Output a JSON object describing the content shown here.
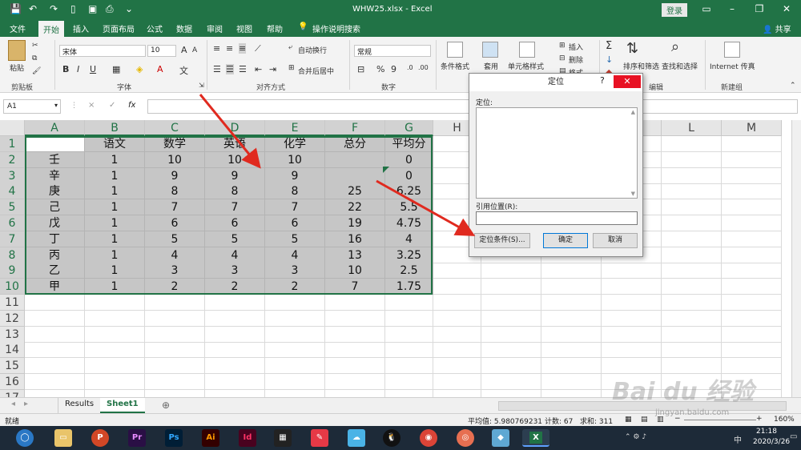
{
  "window": {
    "title": "WHW25.xlsx  -  Excel",
    "login": "登录",
    "share": "共享"
  },
  "tabs": [
    "文件",
    "开始",
    "插入",
    "页面布局",
    "公式",
    "数据",
    "审阅",
    "视图",
    "帮助",
    "操作说明搜索"
  ],
  "ribbon": {
    "clipboard": {
      "paste": "粘贴",
      "group": "剪贴板"
    },
    "font": {
      "name": "宋体",
      "size": "10",
      "bold": "B",
      "italic": "I",
      "underline": "U",
      "grow": "A",
      "shrink": "A",
      "group": "字体"
    },
    "align": {
      "wrap": "自动换行",
      "merge": "合并后居中",
      "group": "对齐方式"
    },
    "number": {
      "format": "常规",
      "percent": "%",
      "comma": "9",
      "group": "数字"
    },
    "styles": {
      "cond": "条件格式",
      "table": "套用",
      "cell": "单元格样式"
    },
    "cells": {
      "insert": "插入",
      "delete": "删除",
      "format": "格式"
    },
    "edit": {
      "sort": "排序和筛选",
      "find": "查找和选择",
      "group": "编辑"
    },
    "new": {
      "internet": "Internet 传真",
      "group": "新建组"
    }
  },
  "formula_bar": {
    "name_box": "A1",
    "cancel": "×",
    "enter": "✓",
    "fx": "fx",
    "value": ""
  },
  "columns": [
    "A",
    "B",
    "C",
    "D",
    "E",
    "F",
    "G",
    "H",
    "I",
    "J",
    "K",
    "L",
    "M"
  ],
  "rows": [
    "1",
    "2",
    "3",
    "4",
    "5",
    "6",
    "7",
    "8",
    "9",
    "10",
    "11",
    "12",
    "13",
    "14",
    "15",
    "16",
    "17"
  ],
  "cells": [
    [
      "",
      "语文",
      "数学",
      "英语",
      "化学",
      "总分",
      "平均分"
    ],
    [
      "壬",
      "1",
      "10",
      "10",
      "10",
      "",
      "0"
    ],
    [
      "辛",
      "1",
      "9",
      "9",
      "9",
      "",
      "0"
    ],
    [
      "庚",
      "1",
      "8",
      "8",
      "8",
      "25",
      "6.25"
    ],
    [
      "己",
      "1",
      "7",
      "7",
      "7",
      "22",
      "5.5"
    ],
    [
      "戊",
      "1",
      "6",
      "6",
      "6",
      "19",
      "4.75"
    ],
    [
      "丁",
      "1",
      "5",
      "5",
      "5",
      "16",
      "4"
    ],
    [
      "丙",
      "1",
      "4",
      "4",
      "4",
      "13",
      "3.25"
    ],
    [
      "乙",
      "1",
      "3",
      "3",
      "3",
      "10",
      "2.5"
    ],
    [
      "甲",
      "1",
      "2",
      "2",
      "2",
      "7",
      "1.75"
    ]
  ],
  "sheets": [
    "Results",
    "Sheet1"
  ],
  "active_sheet": "Sheet1",
  "status": {
    "mode": "就绪",
    "average": "平均值: 5.980769231",
    "count": "计数: 67",
    "sum": "求和: 311",
    "zoom": "160%"
  },
  "dialog": {
    "title": "定位",
    "help": "?",
    "close": "✕",
    "goto_label": "定位:",
    "ref_label": "引用位置(R):",
    "ref_value": "",
    "special_button": "定位条件(S)...",
    "ok_button": "确定",
    "cancel_button": "取消"
  },
  "taskbar": {
    "apps": [
      "Pr",
      "Ps",
      "Ai",
      "Id"
    ],
    "time": "21:18",
    "date": "2020/3/26",
    "lang": "中"
  },
  "watermark": {
    "brand": "Bai du 经验",
    "url": "jingyan.baidu.com"
  },
  "colors": {
    "excel_green": "#217346",
    "selection": "#c6c6c6",
    "arrow": "#e02a1f"
  }
}
